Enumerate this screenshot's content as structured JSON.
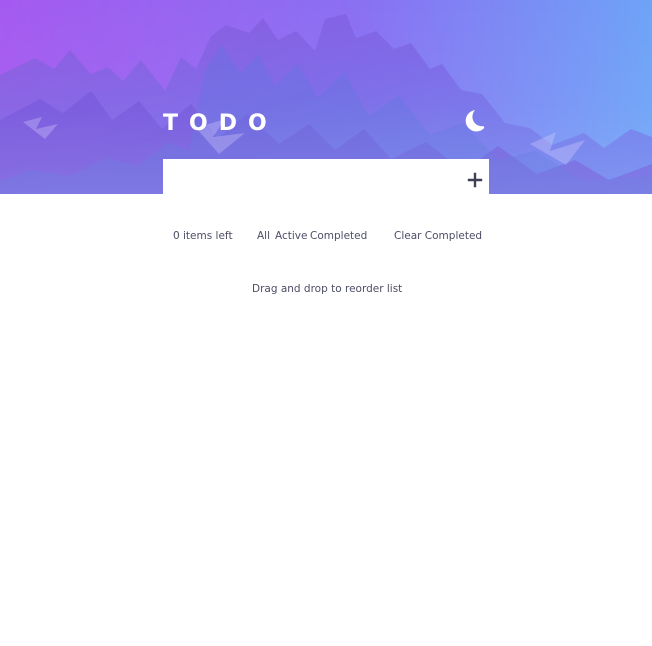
{
  "app": {
    "title": "TODO"
  },
  "header": {
    "theme_toggle_icon": "moon-icon",
    "gradient_start": "#a45af0",
    "gradient_end": "#6ea3f7"
  },
  "new_todo": {
    "value": "",
    "placeholder": "",
    "add_icon": "plus-icon"
  },
  "footer": {
    "items_left": "0 items left",
    "filters": [
      {
        "label": "All"
      },
      {
        "label": "Active"
      },
      {
        "label": "Completed"
      }
    ],
    "clear_completed": "Clear Completed",
    "drag_hint": "Drag and drop to reorder list"
  },
  "colors": {
    "text": "#4d4d66",
    "background": "#ffffff"
  }
}
